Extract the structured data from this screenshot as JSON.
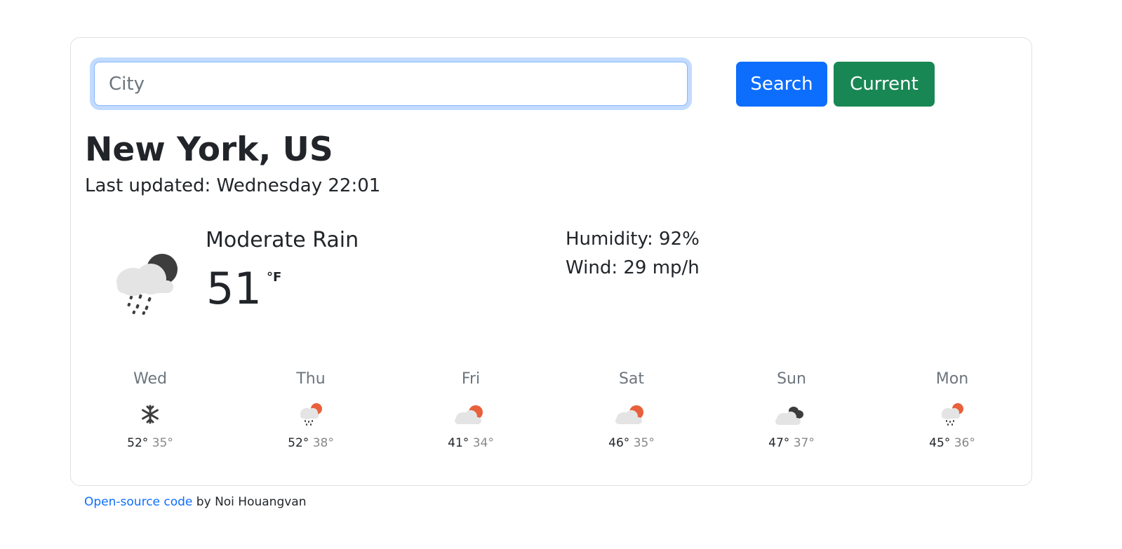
{
  "search": {
    "placeholder": "City",
    "value": "",
    "search_label": "Search",
    "current_label": "Current"
  },
  "location": {
    "name": "New York, US",
    "last_updated": "Last updated: Wednesday 22:01"
  },
  "current": {
    "condition": "Moderate Rain",
    "temperature": "51",
    "unit": "°F",
    "humidity": "Humidity: 92%",
    "wind": "Wind: 29 mp/h",
    "icon": "rain-cloud-moon-icon"
  },
  "forecast": [
    {
      "day": "Wed",
      "max": "52°",
      "min": "35°",
      "icon": "snowflake-icon"
    },
    {
      "day": "Thu",
      "max": "52°",
      "min": "38°",
      "icon": "rain-cloud-sun-icon"
    },
    {
      "day": "Fri",
      "max": "41°",
      "min": "34°",
      "icon": "cloud-sun-icon"
    },
    {
      "day": "Sat",
      "max": "46°",
      "min": "35°",
      "icon": "cloud-sun-icon"
    },
    {
      "day": "Sun",
      "max": "47°",
      "min": "37°",
      "icon": "dark-clouds-icon"
    },
    {
      "day": "Mon",
      "max": "45°",
      "min": "36°",
      "icon": "rain-cloud-sun-icon"
    }
  ],
  "footer": {
    "link_text": "Open-source code",
    "suffix": " by Noi Houangvan"
  },
  "colors": {
    "primary": "#0d6efd",
    "success": "#198754",
    "sun": "#e8603c",
    "dark_cloud": "#3d3d3d"
  }
}
